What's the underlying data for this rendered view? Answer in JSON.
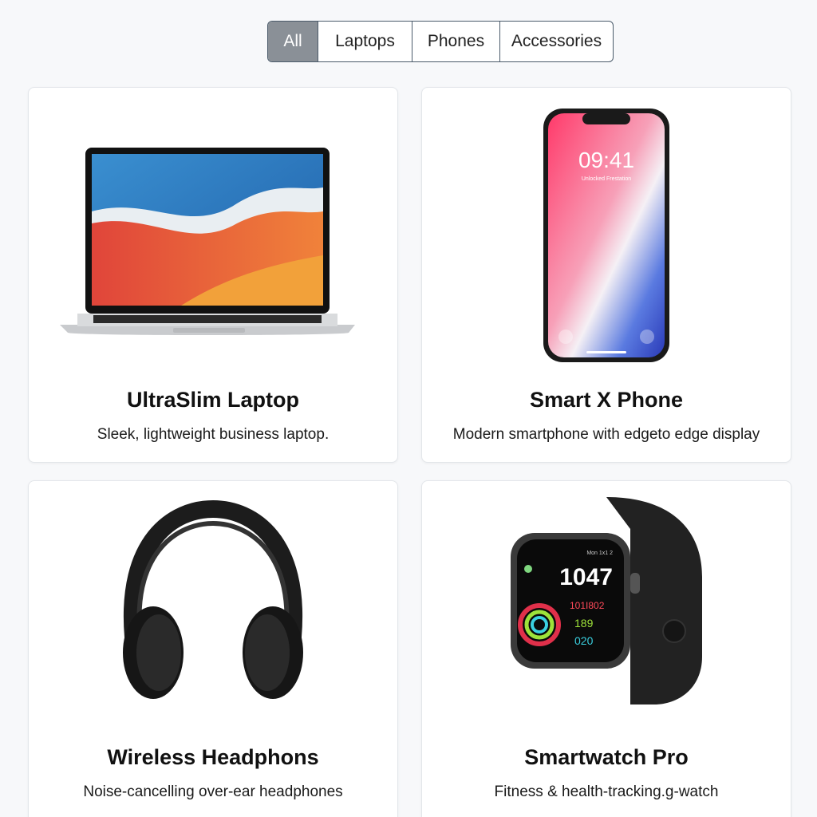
{
  "filters": [
    "All",
    "Laptops",
    "Phones",
    "Accessories"
  ],
  "active_filter": "All",
  "products": [
    {
      "title": "UltraSlim Laptop",
      "description": "Sleek, lightweight business laptop.",
      "icon": "laptop-image"
    },
    {
      "title": "Smart X Phone",
      "description": "Modern smartphone with edgeto edge display",
      "icon": "phone-image",
      "screen_time": "09:41",
      "screen_sub": "Unlocked Frestation"
    },
    {
      "title": "Wireless Headphons",
      "description": "Noise-cancelling over-ear headphones",
      "icon": "headphones-image"
    },
    {
      "title": "Smartwatch Pro",
      "description": "Fitness & health-tracking.g-watch",
      "icon": "watch-image",
      "watch_date": "Mon 1x1 2",
      "watch_time": "1047",
      "watch_stat1": "101I802",
      "watch_stat2": "189",
      "watch_stat3": "020"
    }
  ],
  "colors": {
    "accent": "#8a9097",
    "border": "#4a5a6a",
    "background": "#f7f8fa"
  }
}
